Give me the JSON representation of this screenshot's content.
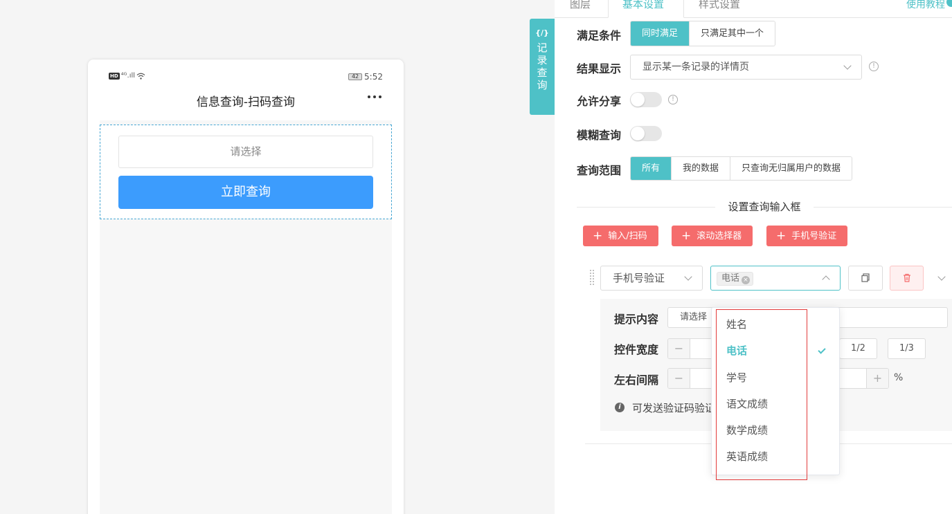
{
  "phone": {
    "status": {
      "network": "⁴ᴳ.ıll",
      "battery": "42",
      "time": "5:52"
    },
    "title": "信息查询-扫码查询",
    "select_placeholder": "请选择",
    "query_button": "立即查询"
  },
  "side_tab": {
    "icon": "{/}",
    "label": "记录查询"
  },
  "top_tabs": [
    {
      "label": "图层"
    },
    {
      "label": "基本设置"
    },
    {
      "label": "样式设置"
    }
  ],
  "help_link": "使用教程",
  "settings": {
    "condition": {
      "label": "满足条件",
      "options": [
        "同时满足",
        "只满足其中一个"
      ],
      "selected": "同时满足"
    },
    "result_display": {
      "label": "结果显示",
      "value": "显示某一条记录的详情页"
    },
    "allow_share": {
      "label": "允许分享",
      "enabled": false
    },
    "fuzzy_query": {
      "label": "模糊查询",
      "enabled": false
    },
    "query_scope": {
      "label": "查询范围",
      "options": [
        "所有",
        "我的数据",
        "只查询无归属用户的数据"
      ],
      "selected": "所有"
    }
  },
  "input_section": {
    "divider_title": "设置查询输入框",
    "add_buttons": [
      "输入/扫码",
      "滚动选择器",
      "手机号验证"
    ],
    "field_type": "手机号验证",
    "field_tag": "电话",
    "hint": {
      "label": "提示内容",
      "value": "请选择"
    },
    "width": {
      "label": "控件宽度",
      "minus": "−",
      "fractions": [
        "1/2",
        "1/3"
      ]
    },
    "spacing": {
      "label": "左右间隔",
      "minus": "−",
      "plus": "+",
      "unit": "%"
    },
    "note": "可发送验证码验证"
  },
  "dropdown": {
    "items": [
      "姓名",
      "电话",
      "学号",
      "语文成绩",
      "数学成绩",
      "英语成绩"
    ],
    "selected": "电话"
  },
  "colors": {
    "accent": "#4ec1c7",
    "danger": "#f56c6c",
    "primary_blue": "#3c9cfd"
  }
}
